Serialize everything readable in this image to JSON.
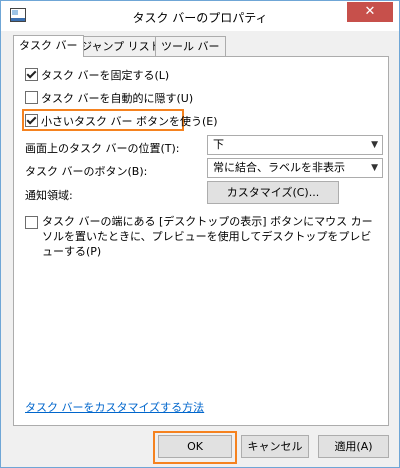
{
  "window": {
    "title": "タスク バーのプロパティ",
    "close_glyph": "✕"
  },
  "tabs": [
    "タスク バー",
    "ジャンプ リスト",
    "ツール バー"
  ],
  "options": {
    "lock": {
      "label": "タスク バーを固定する(L)",
      "checked": true
    },
    "autohide": {
      "label": "タスク バーを自動的に隠す(U)",
      "checked": false
    },
    "small": {
      "label": "小さいタスク バー ボタンを使う(E)",
      "checked": true
    }
  },
  "location": {
    "label": "画面上のタスク バーの位置(T):",
    "value": "下"
  },
  "buttons_setting": {
    "label": "タスク バーのボタン(B):",
    "value": "常に結合、ラベルを非表示"
  },
  "notify": {
    "label": "通知領域:",
    "button": "カスタマイズ(C)..."
  },
  "peek": {
    "label": "タスク バーの端にある [デスクトップの表示] ボタンにマウス カーソルを置いたときに、プレビューを使用してデスクトップをプレビューする(P)",
    "checked": false
  },
  "help_link": "タスク バーをカスタマイズする方法",
  "footer": {
    "ok": "OK",
    "cancel": "キャンセル",
    "apply": "適用(A)"
  },
  "colors": {
    "highlight": "#f5821f",
    "link": "#0066cc",
    "close": "#c7504b"
  }
}
